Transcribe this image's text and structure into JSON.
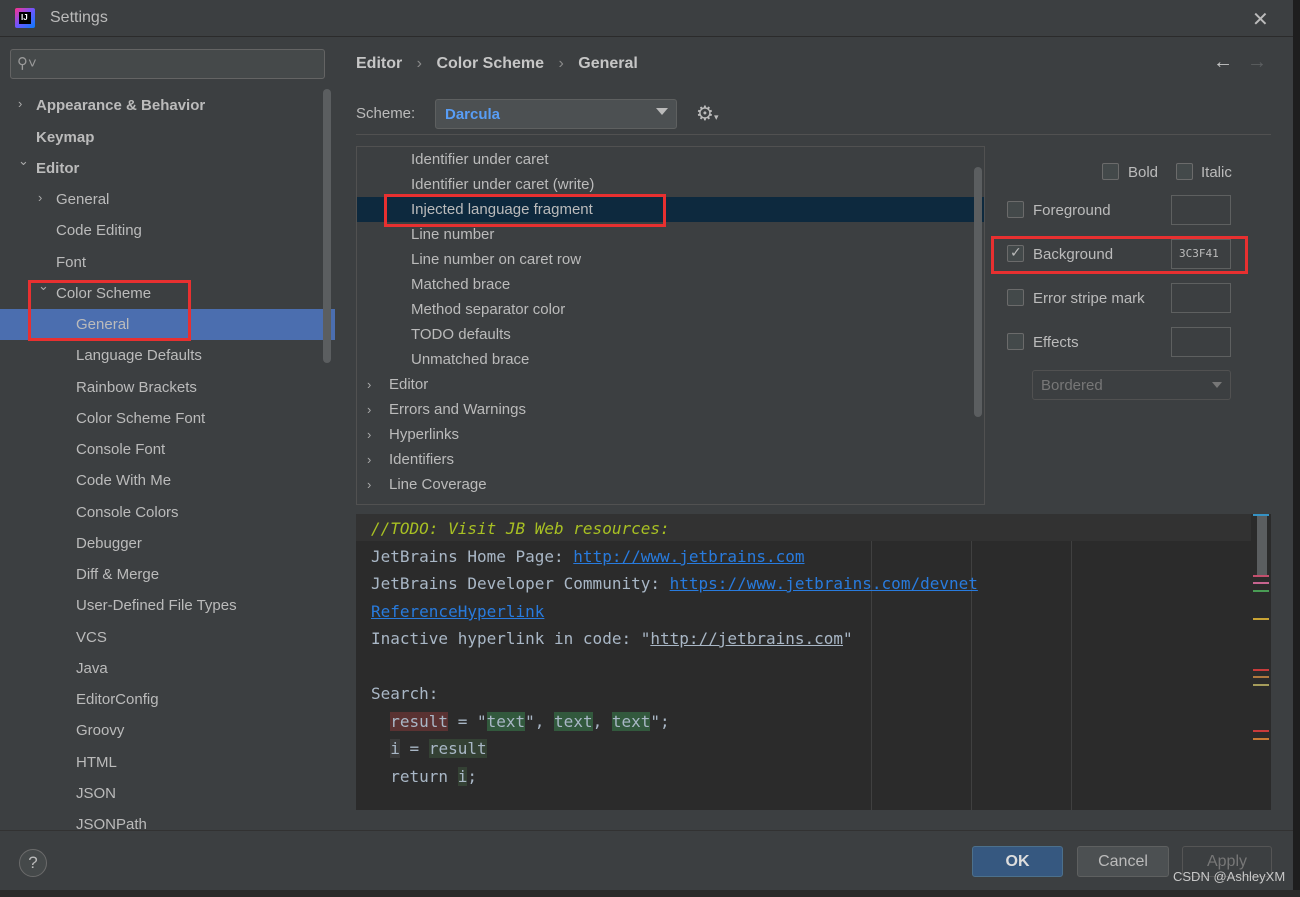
{
  "window": {
    "title": "Settings",
    "close_glyph": "✕"
  },
  "sidebar": {
    "search_placeholder": "",
    "items": [
      {
        "label": "Appearance & Behavior",
        "arrow": "›"
      },
      {
        "label": "Keymap"
      },
      {
        "label": "Editor",
        "arrow": "⌄"
      },
      {
        "label": "General",
        "arrow": "›"
      },
      {
        "label": "Code Editing"
      },
      {
        "label": "Font"
      },
      {
        "label": "Color Scheme",
        "arrow": "⌄"
      },
      {
        "label": "General"
      },
      {
        "label": "Language Defaults"
      },
      {
        "label": "Rainbow Brackets"
      },
      {
        "label": "Color Scheme Font"
      },
      {
        "label": "Console Font"
      },
      {
        "label": "Code With Me"
      },
      {
        "label": "Console Colors"
      },
      {
        "label": "Debugger"
      },
      {
        "label": "Diff & Merge"
      },
      {
        "label": "User-Defined File Types"
      },
      {
        "label": "VCS"
      },
      {
        "label": "Java"
      },
      {
        "label": "EditorConfig"
      },
      {
        "label": "Groovy"
      },
      {
        "label": "HTML"
      },
      {
        "label": "JSON"
      },
      {
        "label": "JSONPath"
      }
    ]
  },
  "breadcrumb": {
    "items": [
      "Editor",
      "Color Scheme",
      "General"
    ],
    "sep": "›",
    "back": "←",
    "forward": "→"
  },
  "scheme": {
    "label": "Scheme:",
    "value": "Darcula"
  },
  "tree": {
    "rows": [
      {
        "label": "Identifier under caret"
      },
      {
        "label": "Identifier under caret (write)"
      },
      {
        "label": "Injected language fragment",
        "selected": true
      },
      {
        "label": "Line number"
      },
      {
        "label": "Line number on caret row"
      },
      {
        "label": "Matched brace"
      },
      {
        "label": "Method separator color"
      },
      {
        "label": "TODO defaults"
      },
      {
        "label": "Unmatched brace"
      },
      {
        "label": "Editor",
        "arrow": "›"
      },
      {
        "label": "Errors and Warnings",
        "arrow": "›"
      },
      {
        "label": "Hyperlinks",
        "arrow": "›"
      },
      {
        "label": "Identifiers",
        "arrow": "›"
      },
      {
        "label": "Line Coverage",
        "arrow": "›"
      }
    ]
  },
  "attributes": {
    "bold": "Bold",
    "italic": "Italic",
    "foreground": "Foreground",
    "background": "Background",
    "background_value": "3C3F41",
    "error_stripe": "Error stripe mark",
    "effects": "Effects",
    "effect_type": "Bordered"
  },
  "preview": {
    "todo": "//TODO: Visit JB Web resources:",
    "home_label": "JetBrains Home Page: ",
    "home_url": "http://www.jetbrains.com",
    "dev_label": "JetBrains Developer Community: ",
    "dev_url": "https://www.jetbrains.com/devnet",
    "ref_link": "ReferenceHyperlink",
    "inactive_label": "Inactive hyperlink in code: ",
    "inactive_url": "http://jetbrains.com",
    "search_label": "Search:",
    "result": "result",
    "assign": " = ",
    "text": "text",
    "i": "i",
    "return_kw": "return ",
    "semicolon": ";"
  },
  "footer": {
    "help": "?",
    "ok": "OK",
    "cancel": "Cancel",
    "apply": "Apply"
  },
  "watermark": "CSDN @AshleyXM"
}
